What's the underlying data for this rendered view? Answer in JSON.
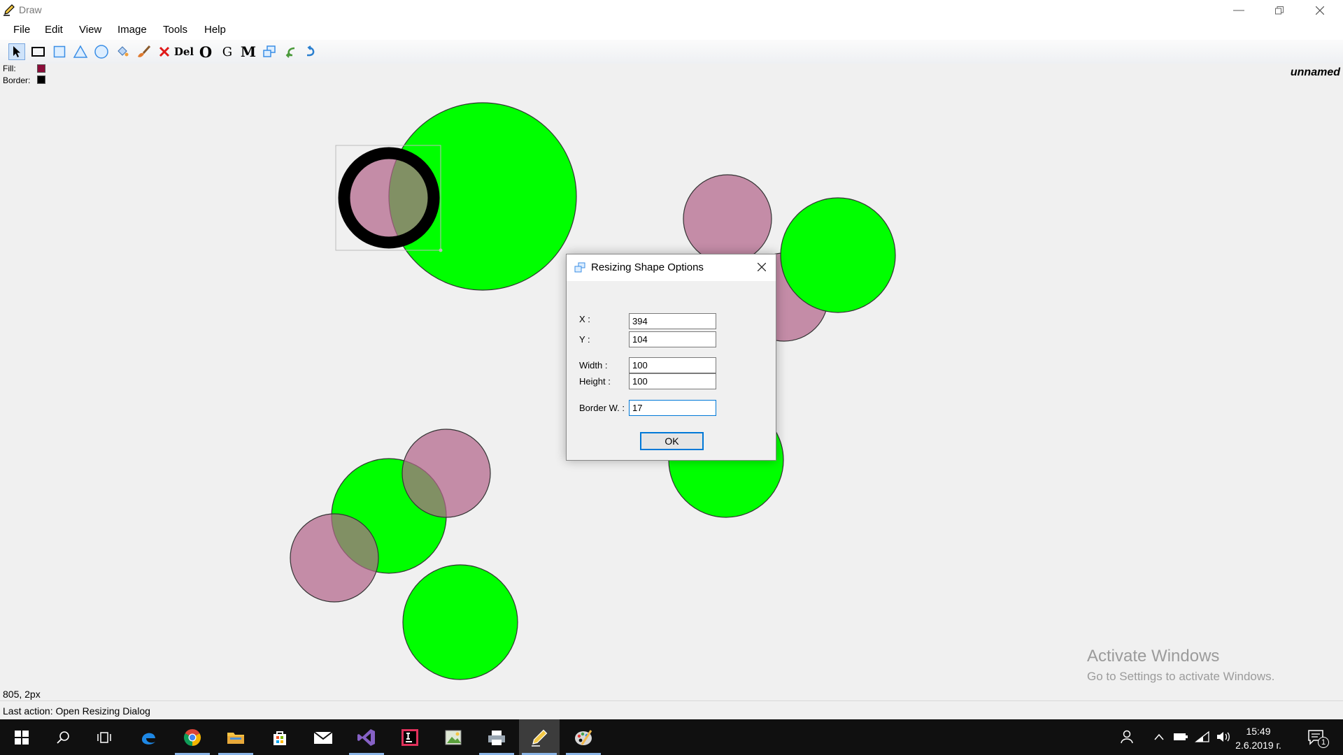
{
  "window": {
    "title": "Draw"
  },
  "menu": [
    "File",
    "Edit",
    "View",
    "Image",
    "Tools",
    "Help"
  ],
  "swatches": {
    "fill_label": "Fill:",
    "fill_color": "#8b0d3a",
    "border_label": "Border:",
    "border_color": "#000000"
  },
  "document_name": "unnamed",
  "toolbar": {
    "delete_label": "Del",
    "o_label": "O",
    "g_label": "G",
    "m_label": "M"
  },
  "colors": {
    "green": "#00ff00",
    "mauve": "#b3658b",
    "stroke": "#333333"
  },
  "dialog": {
    "title": "Resizing Shape Options",
    "x_label": "X :",
    "x_value": "394",
    "y_label": "Y :",
    "y_value": "104",
    "width_label": "Width :",
    "width_value": "100",
    "height_label": "Height :",
    "height_value": "100",
    "border_label": "Border W. :",
    "border_value": "17",
    "ok_label": "OK"
  },
  "status": {
    "coords": "805, 2px",
    "last_action": "Last action: Open Resizing Dialog"
  },
  "watermark": {
    "title": "Activate Windows",
    "subtitle": "Go to Settings to activate Windows."
  },
  "taskbar": {
    "time": "15:49",
    "date": "2.6.2019 г.",
    "notification_count": "1"
  }
}
